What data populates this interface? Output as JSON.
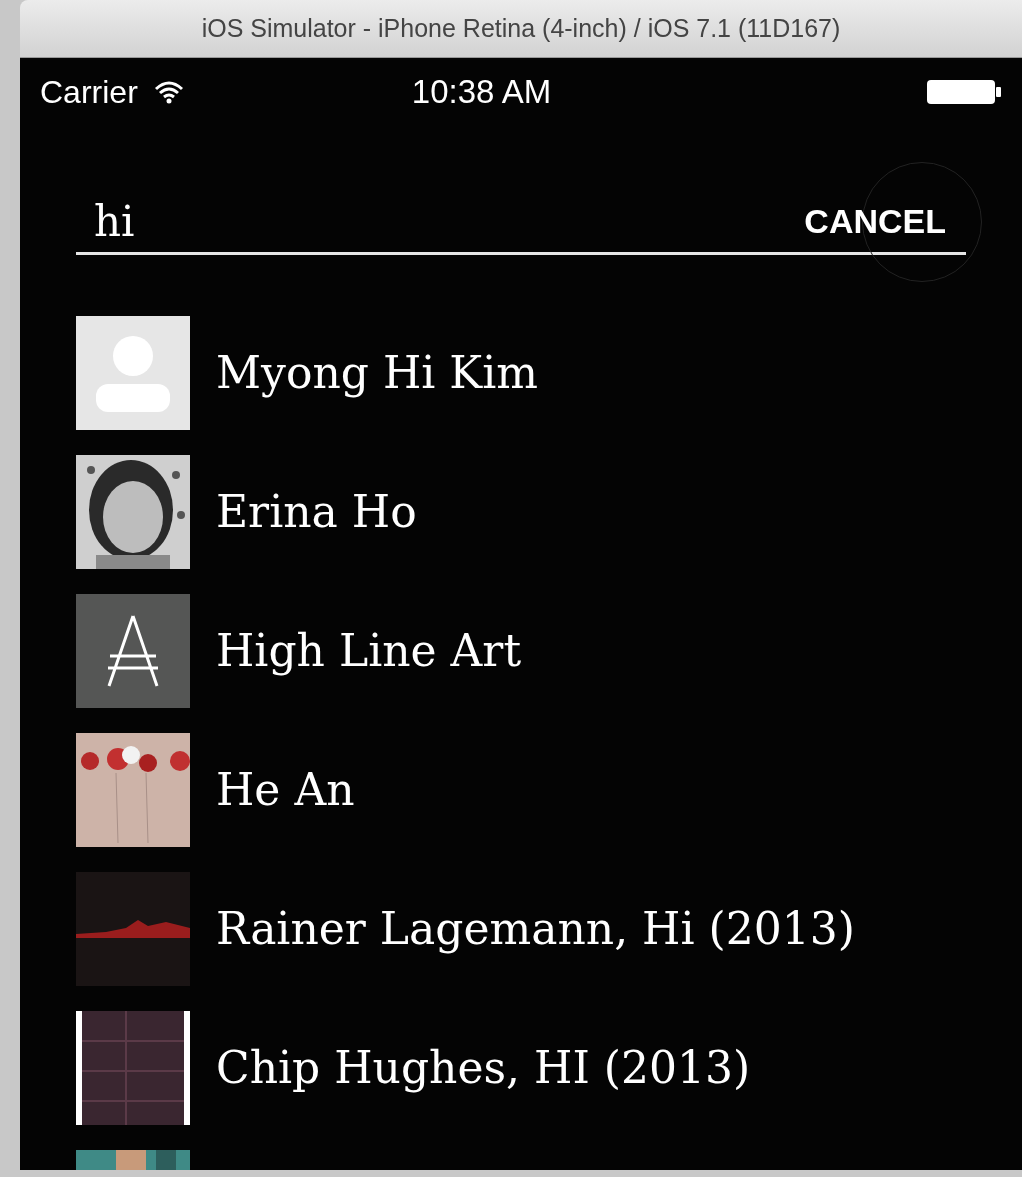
{
  "window": {
    "title": "iOS Simulator - iPhone Retina (4-inch) / iOS 7.1 (11D167)"
  },
  "status_bar": {
    "carrier": "Carrier",
    "time": "10:38 AM"
  },
  "search": {
    "value": "hi",
    "cancel": "CANCEL"
  },
  "results": [
    {
      "name": "Myong Hi Kim",
      "kind": "avatar"
    },
    {
      "name": "Erina Ho"
    },
    {
      "name": "High Line Art",
      "kind": "logo"
    },
    {
      "name": "He An",
      "kind": "art-flowers"
    },
    {
      "name": "Rainer Lagemann, Hi (2013)",
      "kind": "art-dark"
    },
    {
      "name": "Chip Hughes, HI (2013)",
      "kind": "art-grid"
    },
    {
      "kind": "art-teal"
    }
  ]
}
